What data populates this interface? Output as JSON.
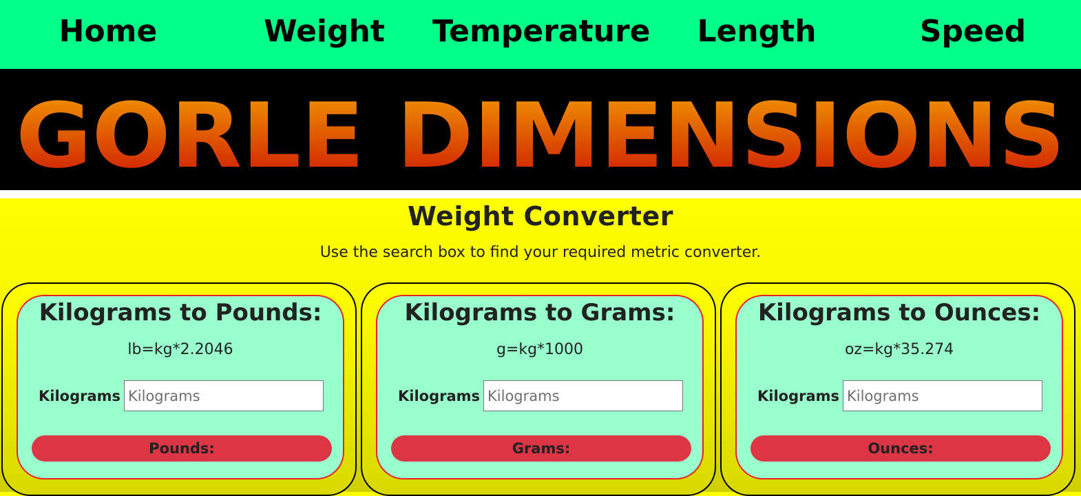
{
  "nav": {
    "items": [
      {
        "label": "Home"
      },
      {
        "label": "Weight"
      },
      {
        "label": "Temperature"
      },
      {
        "label": "Length"
      },
      {
        "label": "Speed"
      }
    ]
  },
  "banner": {
    "logo_text": "GORLE DIMENSIONS",
    "colors": {
      "background": "#000000",
      "gradient_top": "#f4a000",
      "gradient_bottom": "#cc1100"
    }
  },
  "main": {
    "title": "Weight Converter",
    "subtitle": "Use the search box to find your required metric converter."
  },
  "cards": [
    {
      "title": "Kilograms to Pounds:",
      "formula": "lb=kg*2.2046",
      "input_label": "Kilograms",
      "input_placeholder": "Kilograms",
      "input_value": "",
      "result_label": "Pounds:"
    },
    {
      "title": "Kilograms to Grams:",
      "formula": "g=kg*1000",
      "input_label": "Kilograms",
      "input_placeholder": "Kilograms",
      "input_value": "",
      "result_label": "Grams:"
    },
    {
      "title": "Kilograms to Ounces:",
      "formula": "oz=kg*35.274",
      "input_label": "Kilograms",
      "input_placeholder": "Kilograms",
      "input_value": "",
      "result_label": "Ounces:"
    }
  ],
  "colors": {
    "nav_bg": "#00ff88",
    "page_bg": "#ffff00",
    "card_bg": "#99ffcc",
    "card_border": "#e8202a",
    "button_bg": "#dc3545"
  }
}
